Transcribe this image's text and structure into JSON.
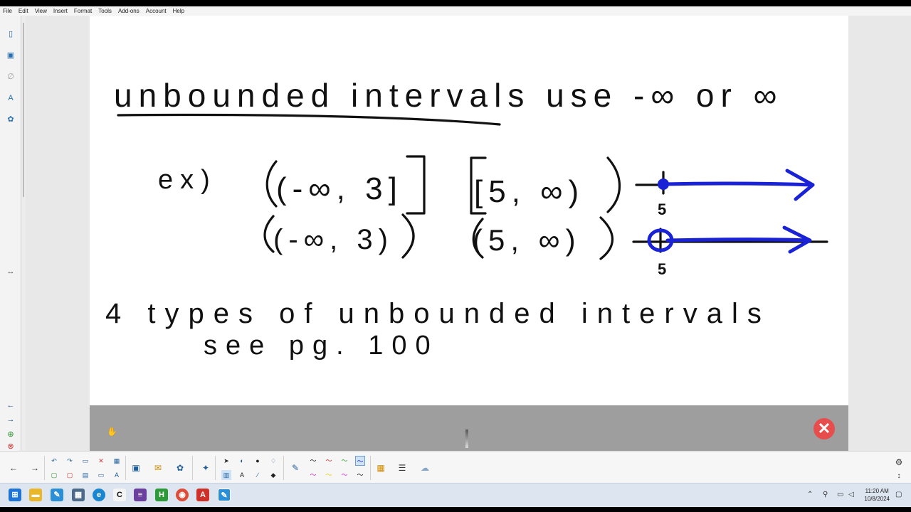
{
  "menu": [
    "File",
    "Edit",
    "View",
    "Insert",
    "Format",
    "Tools",
    "Add-ons",
    "Account",
    "Help"
  ],
  "left_toolbar": {
    "icons": [
      "page-sorter-icon",
      "gallery-icon",
      "attachments-icon",
      "properties-icon",
      "add-ons-icon",
      "previous-page-icon",
      "next-page-icon",
      "add-page-icon",
      "delete-page-icon"
    ]
  },
  "handwriting": {
    "heading": "unbounded intervals use -∞ or ∞",
    "example_label": "ex)",
    "ex1": "(-∞, 3]",
    "ex2": "(-∞, 3)",
    "ex3": "[5, ∞)",
    "ex4": "(5, ∞)",
    "nl1_label": "5",
    "nl2_label": "5",
    "line1": "4 types of unbounded intervals",
    "line2": "see pg. 100"
  },
  "colors": {
    "ink": "#111111",
    "blue_ink": "#1a22d6",
    "close_button": "#e84d4d"
  },
  "close_button_glyph": "✕",
  "bottom_toolbar": {
    "icons": [
      "previous-page-icon",
      "next-page-icon",
      "undo-icon",
      "redo-icon",
      "clear-icon",
      "delete-icon",
      "table-icon",
      "screen-shade-icon",
      "blank-page-icon",
      "insert-icon",
      "add-ons-icon",
      "select-icon",
      "text-icon",
      "line-icon",
      "eraser-icon",
      "fill-icon",
      "pen-icon",
      "color-grid-icon",
      "line-style-icon",
      "properties-icon",
      "settings-icon"
    ]
  },
  "taskbar": {
    "time": "11:20 AM",
    "date": "10/8/2024"
  }
}
